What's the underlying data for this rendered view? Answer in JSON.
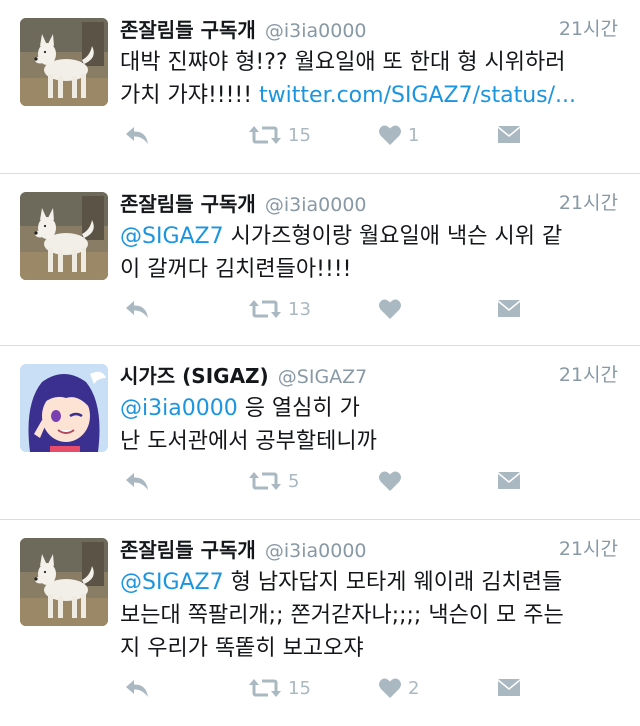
{
  "tweets": [
    {
      "name": "존잘림들 구독개",
      "handle": "@i3ia0000",
      "time": "21시간",
      "avatar": "dog-avatar",
      "text_lines": [
        [
          {
            "t": "대박 진쨔야 형!?? 월요일애 또 한대 형 시위하러",
            "link": false
          }
        ],
        [
          {
            "t": "가치 가쟈!!!!! ",
            "link": false
          },
          {
            "t": "twitter.com/SIGAZ7/status/...",
            "link": true
          }
        ]
      ],
      "retweets": "15",
      "likes": "1"
    },
    {
      "name": "존잘림들 구독개",
      "handle": "@i3ia0000",
      "time": "21시간",
      "avatar": "dog-avatar",
      "text_lines": [
        [
          {
            "t": "@SIGAZ7",
            "link": true
          },
          {
            "t": " 시가즈형이랑 월요일애 낵슨 시위 같",
            "link": false
          }
        ],
        [
          {
            "t": "이 갈꺼다 김치련들아!!!!",
            "link": false
          }
        ]
      ],
      "retweets": "13",
      "likes": ""
    },
    {
      "name": "시가즈 (SIGAZ)",
      "handle": "@SIGAZ7",
      "time": "21시간",
      "avatar": "anime-girl-avatar",
      "text_lines": [
        [
          {
            "t": "@i3ia0000",
            "link": true
          },
          {
            "t": " 응 열심히 가",
            "link": false
          }
        ],
        [
          {
            "t": "난 도서관에서 공부할테니까",
            "link": false
          }
        ]
      ],
      "retweets": "5",
      "likes": ""
    },
    {
      "name": "존잘림들 구독개",
      "handle": "@i3ia0000",
      "time": "21시간",
      "avatar": "dog-avatar",
      "text_lines": [
        [
          {
            "t": "@SIGAZ7",
            "link": true
          },
          {
            "t": " 형 남자답지 모타게 웨이래 김치련들",
            "link": false
          }
        ],
        [
          {
            "t": "보는대 쪽팔리개;; 쫀거갇자나;;;; 낵슨이 모 주는",
            "link": false
          }
        ],
        [
          {
            "t": "지 우리가 똑똩히 보고오쟈",
            "link": false
          }
        ]
      ],
      "retweets": "15",
      "likes": "2"
    }
  ],
  "icons": {
    "reply": "reply-icon",
    "retweet": "retweet-icon",
    "like": "heart-icon",
    "dm": "envelope-icon"
  },
  "colors": {
    "link": "#1b95e0",
    "icon": "#aab8c2",
    "meta": "#8899a6",
    "divider": "#d8dde2"
  }
}
